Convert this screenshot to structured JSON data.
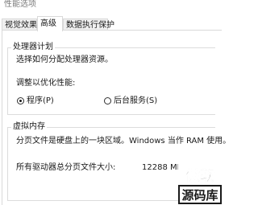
{
  "window": {
    "title": "性能选项"
  },
  "tabs": [
    {
      "label": "视觉效果",
      "selected": false
    },
    {
      "label": "高级",
      "selected": true
    },
    {
      "label": "数据执行保护",
      "selected": false
    }
  ],
  "processor_scheduling": {
    "legend": "处理器计划",
    "description": "选择如何分配处理器资源。",
    "adjust_label": "调整以优化性能:",
    "options": [
      {
        "label": "程序(P)",
        "checked": true
      },
      {
        "label": "后台服务(S)",
        "checked": false
      }
    ]
  },
  "virtual_memory": {
    "legend": "虚拟内存",
    "description": "分页文件是硬盘上的一块区域。Windows 当作 RAM 使用。",
    "total_label": "所有驱动器总分页文件大小:",
    "total_value": "12288 MB"
  },
  "watermark": {
    "line1": "傲软",
    "line2": "源码库"
  },
  "colors": {
    "border": "#d9d9d9",
    "text": "#1a1a1a",
    "title_text": "#7a7a7a",
    "tab_bg": "#f0f0f0"
  }
}
